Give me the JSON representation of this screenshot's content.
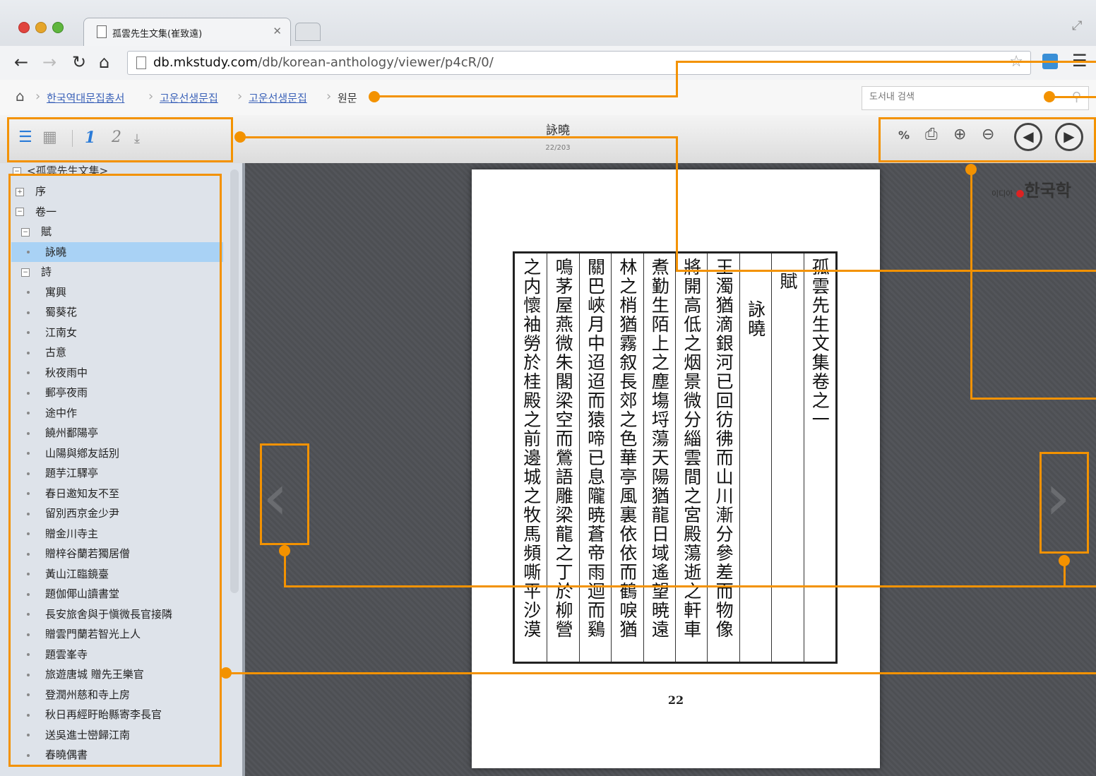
{
  "browser": {
    "tab_title": "孤雲先生文集(崔致遠)",
    "url_host": "db.mkstudy.com",
    "url_path": "/db/korean-anthology/viewer/p4cR/0/"
  },
  "breadcrumb": [
    "한국역대문집총서",
    "고운선생문집",
    "고운선생문집",
    "원문"
  ],
  "search": {
    "placeholder": "도서내 검색"
  },
  "viewer": {
    "title": "詠曉",
    "page_counter": "22/203"
  },
  "tree": {
    "root": "<孤雲先生文集>",
    "nodes": [
      {
        "label": "序",
        "kind": "expand-plus",
        "level": 0
      },
      {
        "label": "卷一",
        "kind": "expand-minus",
        "level": 0
      },
      {
        "label": "賦",
        "kind": "expand-minus",
        "level": 1
      },
      {
        "label": "詠曉",
        "kind": "leaf",
        "level": 1,
        "selected": true
      },
      {
        "label": "詩",
        "kind": "expand-minus",
        "level": 1
      },
      {
        "label": "寓興",
        "kind": "leaf",
        "level": 1
      },
      {
        "label": "蜀葵花",
        "kind": "leaf",
        "level": 1
      },
      {
        "label": "江南女",
        "kind": "leaf",
        "level": 1
      },
      {
        "label": "古意",
        "kind": "leaf",
        "level": 1
      },
      {
        "label": "秋夜雨中",
        "kind": "leaf",
        "level": 1
      },
      {
        "label": "郵亭夜雨",
        "kind": "leaf",
        "level": 1
      },
      {
        "label": "途中作",
        "kind": "leaf",
        "level": 1
      },
      {
        "label": "饒州鄱陽亭",
        "kind": "leaf",
        "level": 1
      },
      {
        "label": "山陽與鄕友話別",
        "kind": "leaf",
        "level": 1
      },
      {
        "label": "題芋江驛亭",
        "kind": "leaf",
        "level": 1
      },
      {
        "label": "春日邀知友不至",
        "kind": "leaf",
        "level": 1
      },
      {
        "label": "留別西京金少尹",
        "kind": "leaf",
        "level": 1
      },
      {
        "label": "贈金川寺主",
        "kind": "leaf",
        "level": 1
      },
      {
        "label": "贈梓谷蘭若獨居僧",
        "kind": "leaf",
        "level": 1
      },
      {
        "label": "黃山江臨鏡臺",
        "kind": "leaf",
        "level": 1
      },
      {
        "label": "題伽倻山讀書堂",
        "kind": "leaf",
        "level": 1
      },
      {
        "label": "長安旅舍與于愼微長官接隣",
        "kind": "leaf",
        "level": 1
      },
      {
        "label": "贈雲門蘭若智光上人",
        "kind": "leaf",
        "level": 1
      },
      {
        "label": "題雲峯寺",
        "kind": "leaf",
        "level": 1
      },
      {
        "label": "旅遊唐城 贈先王樂官",
        "kind": "leaf",
        "level": 1
      },
      {
        "label": "登潤州慈和寺上房",
        "kind": "leaf",
        "level": 1
      },
      {
        "label": "秋日再經盱眙縣寄李長官",
        "kind": "leaf",
        "level": 1
      },
      {
        "label": "送吳進士巒歸江南",
        "kind": "leaf",
        "level": 1
      },
      {
        "label": "春曉偶書",
        "kind": "leaf",
        "level": 1
      }
    ]
  },
  "scan": {
    "columns": [
      "孤雲先生文集卷之一",
      "賦",
      "詠曉",
      "王濁猶滴銀河已回彷彿而山川漸分參差而物像",
      "將開高低之烟景微分緇雲間之宮殿蕩逝之軒車",
      "煮勤生陌上之塵塲埒蕩天陽猶龍日域遙望暁遠",
      "林之梢猶霧叙長郊之色華亭風裏依依而鶴唳猶",
      "關巴峽月中迢迢而猿啼已息隴暁蒼帝雨迴而鷄",
      "鳴茅屋燕微朱閣梁空而鶯語雕梁龍之丁於柳營",
      "之内懷袖勞於桂殿之前邊城之牧馬頻嘶平沙漠"
    ],
    "page_number": "22"
  },
  "logo": {
    "prefix": "이디아",
    "name": "한국학"
  }
}
